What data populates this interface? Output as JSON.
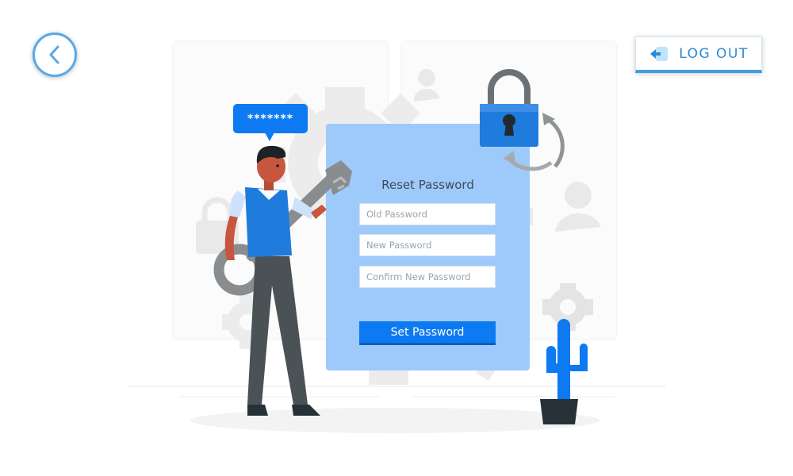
{
  "header": {
    "logout_label": "LOG OUT"
  },
  "bubble": {
    "masked_password": "*******"
  },
  "form": {
    "title": "Reset Password",
    "old_password_placeholder": "Old Password",
    "new_password_placeholder": "New Password",
    "confirm_password_placeholder": "Confirm New Password",
    "submit_label": "Set Password"
  },
  "icons": {
    "back": "chevron-left-icon",
    "logout": "logout-door-icon",
    "lock": "padlock-icon",
    "refresh": "refresh-arrows-icon",
    "key": "key-icon",
    "cactus": "cactus-icon",
    "person": "user-silhouette-icon",
    "gear": "gear-icon"
  },
  "colors": {
    "primary": "#0d7af1",
    "card": "#9dcafb",
    "accent": "#3f9de0",
    "lock_body": "#1f7bdc"
  }
}
